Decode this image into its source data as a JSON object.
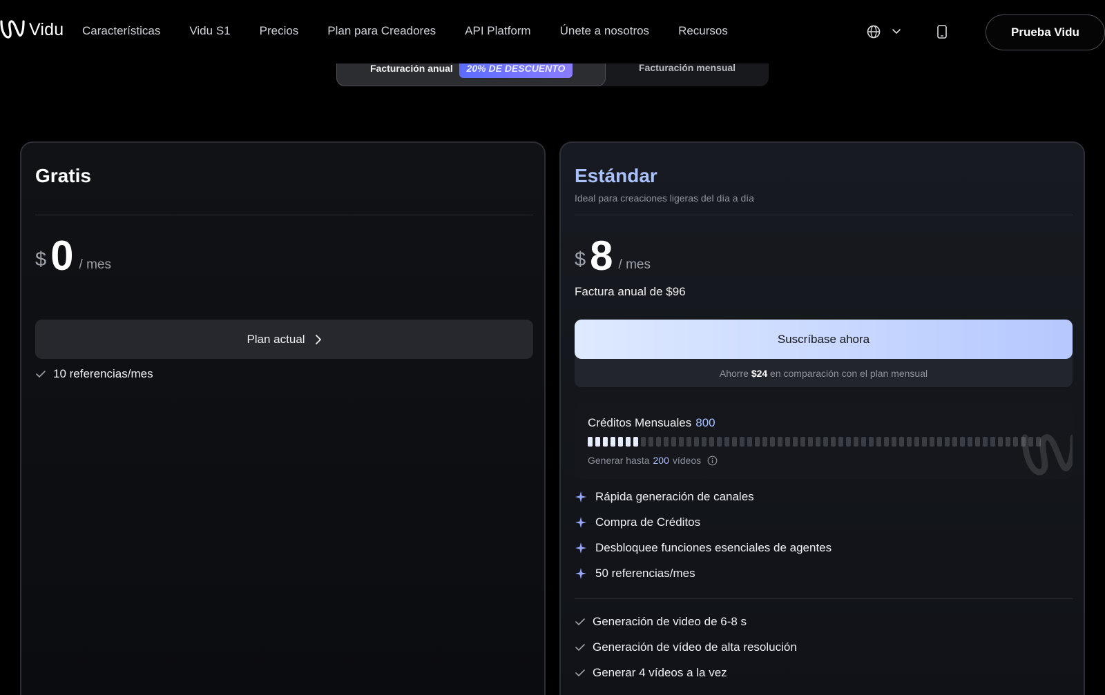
{
  "nav": {
    "logo_text": "Vidu",
    "links": [
      "Características",
      "Vidu S1",
      "Precios",
      "Plan para Creadores",
      "API Platform",
      "Únete a nosotros",
      "Recursos"
    ],
    "cta": "Prueba Vidu"
  },
  "billing": {
    "annual_label": "Facturación anual",
    "discount_badge": "20% DE DESCUENTO",
    "monthly_label": "Facturación mensual"
  },
  "free_plan": {
    "name": "Gratis",
    "currency": "$",
    "amount": "0",
    "period": "/ mes",
    "button": "Plan actual",
    "features": [
      "10 referencias/mes"
    ]
  },
  "standard_plan": {
    "name": "Estándar",
    "subtitle": "Ideal para creaciones ligeras del día a día",
    "currency": "$",
    "amount": "8",
    "period": "/ mes",
    "annual_bill": "Factura anual de $96",
    "button": "Suscríbase ahora",
    "save_prefix": "Ahorre ",
    "save_amount": "$24",
    "save_suffix": " en comparación con el plan mensual",
    "credits_label": "Créditos Mensuales",
    "credits_value": "800",
    "credits_fill_segments": 7,
    "credits_total_segments": 60,
    "videos_prefix": "Generar hasta ",
    "videos_value": "200",
    "videos_suffix": " vídeos",
    "highlights": [
      "Rápida generación de canales",
      "Compra de Créditos",
      "Desbloquee funciones esenciales de agentes",
      "50 referencias/mes"
    ],
    "features": [
      "Generación de video de 6-8 s",
      "Generación de vídeo de alta resolución",
      "Generar 4 vídeos a la vez"
    ]
  },
  "colors": {
    "accent": "#a9c2ff",
    "discount_gradient_start": "#5d6cff",
    "sparkle": "#9aa8ff"
  }
}
